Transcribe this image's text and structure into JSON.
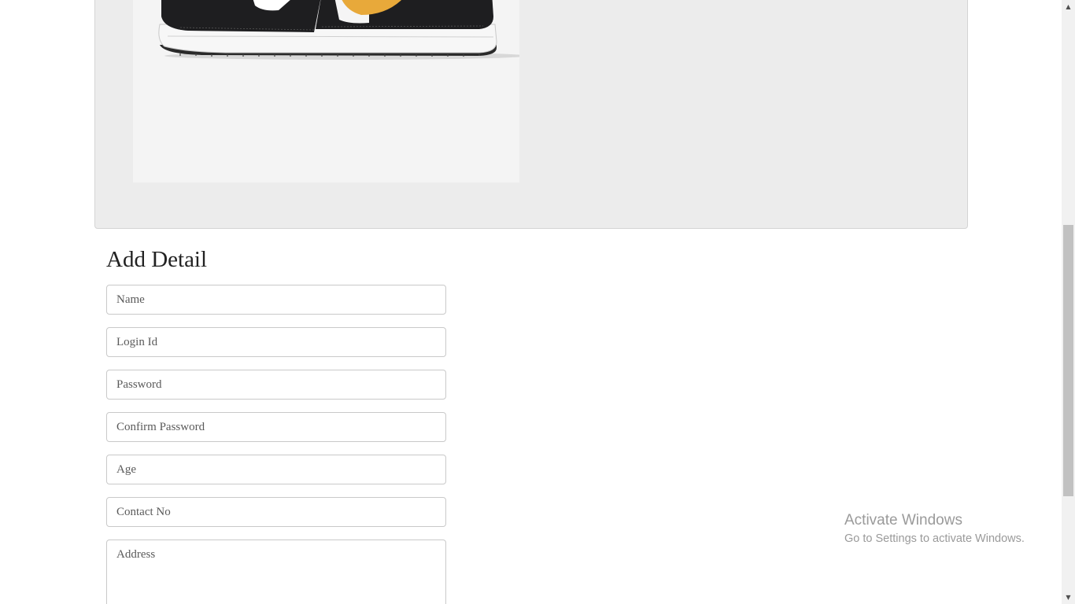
{
  "product": {
    "image_alt": "Black, white and yellow low-top sneaker",
    "colors": {
      "black": "#1c1c1e",
      "white": "#ffffff",
      "accent": "#e8a93a"
    }
  },
  "form": {
    "heading": "Add Detail",
    "fields": {
      "name": "Name",
      "login_id": "Login Id",
      "password": "Password",
      "confirm_password": "Confirm Password",
      "age": "Age",
      "contact_no": "Contact No",
      "address": "Address"
    }
  },
  "watermark": {
    "title": "Activate Windows",
    "subtitle": "Go to Settings to activate Windows."
  }
}
